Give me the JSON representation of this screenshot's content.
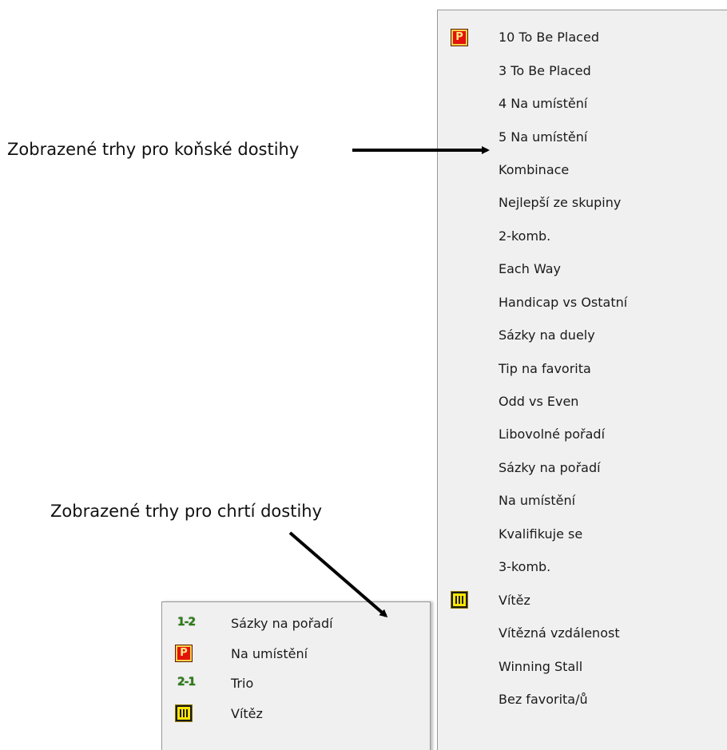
{
  "annotations": {
    "horse_label": "Zobrazené trhy pro koňské dostihy",
    "greyhound_label": "Zobrazené trhy pro chrtí dostihy"
  },
  "main_menu": {
    "items": [
      {
        "label": "10 To Be Placed",
        "icon": "place-icon"
      },
      {
        "label": "3 To Be Placed",
        "icon": null
      },
      {
        "label": "4 Na umístění",
        "icon": null
      },
      {
        "label": "5 Na umístění",
        "icon": null
      },
      {
        "label": "Kombinace",
        "icon": null
      },
      {
        "label": "Nejlepší ze skupiny",
        "icon": null
      },
      {
        "label": "2-komb.",
        "icon": null
      },
      {
        "label": "Each Way",
        "icon": null
      },
      {
        "label": "Handicap vs Ostatní",
        "icon": null
      },
      {
        "label": "Sázky na duely",
        "icon": null
      },
      {
        "label": "Tip na favorita",
        "icon": null
      },
      {
        "label": "Odd vs Even",
        "icon": null
      },
      {
        "label": "Libovolné pořadí",
        "icon": null
      },
      {
        "label": "Sázky na pořadí",
        "icon": null
      },
      {
        "label": "Na umístění",
        "icon": null
      },
      {
        "label": "Kvalifikuje se",
        "icon": null
      },
      {
        "label": "3-komb.",
        "icon": null
      },
      {
        "label": "Vítěz",
        "icon": "win-icon"
      },
      {
        "label": "Vítězná vzdálenost",
        "icon": null
      },
      {
        "label": "Winning Stall",
        "icon": null
      },
      {
        "label": "Bez favorita/ů",
        "icon": null
      }
    ]
  },
  "greyhound_menu": {
    "items": [
      {
        "label": "Sázky na pořadí",
        "icon": "forecast-icon",
        "icon_text": "1-2"
      },
      {
        "label": "Na umístění",
        "icon": "place-icon"
      },
      {
        "label": "Trio",
        "icon": "reverse-forecast-icon",
        "icon_text": "2-1"
      },
      {
        "label": "Vítěz",
        "icon": "win-icon"
      }
    ]
  },
  "icons": {
    "place_letter": "P"
  },
  "colors": {
    "menu_background": "#f0f0f0",
    "menu_border": "#979797",
    "place_icon_red": "#e3120b",
    "win_icon_yellow": "#ffe600",
    "order_icon_green": "#2e7d1a"
  }
}
